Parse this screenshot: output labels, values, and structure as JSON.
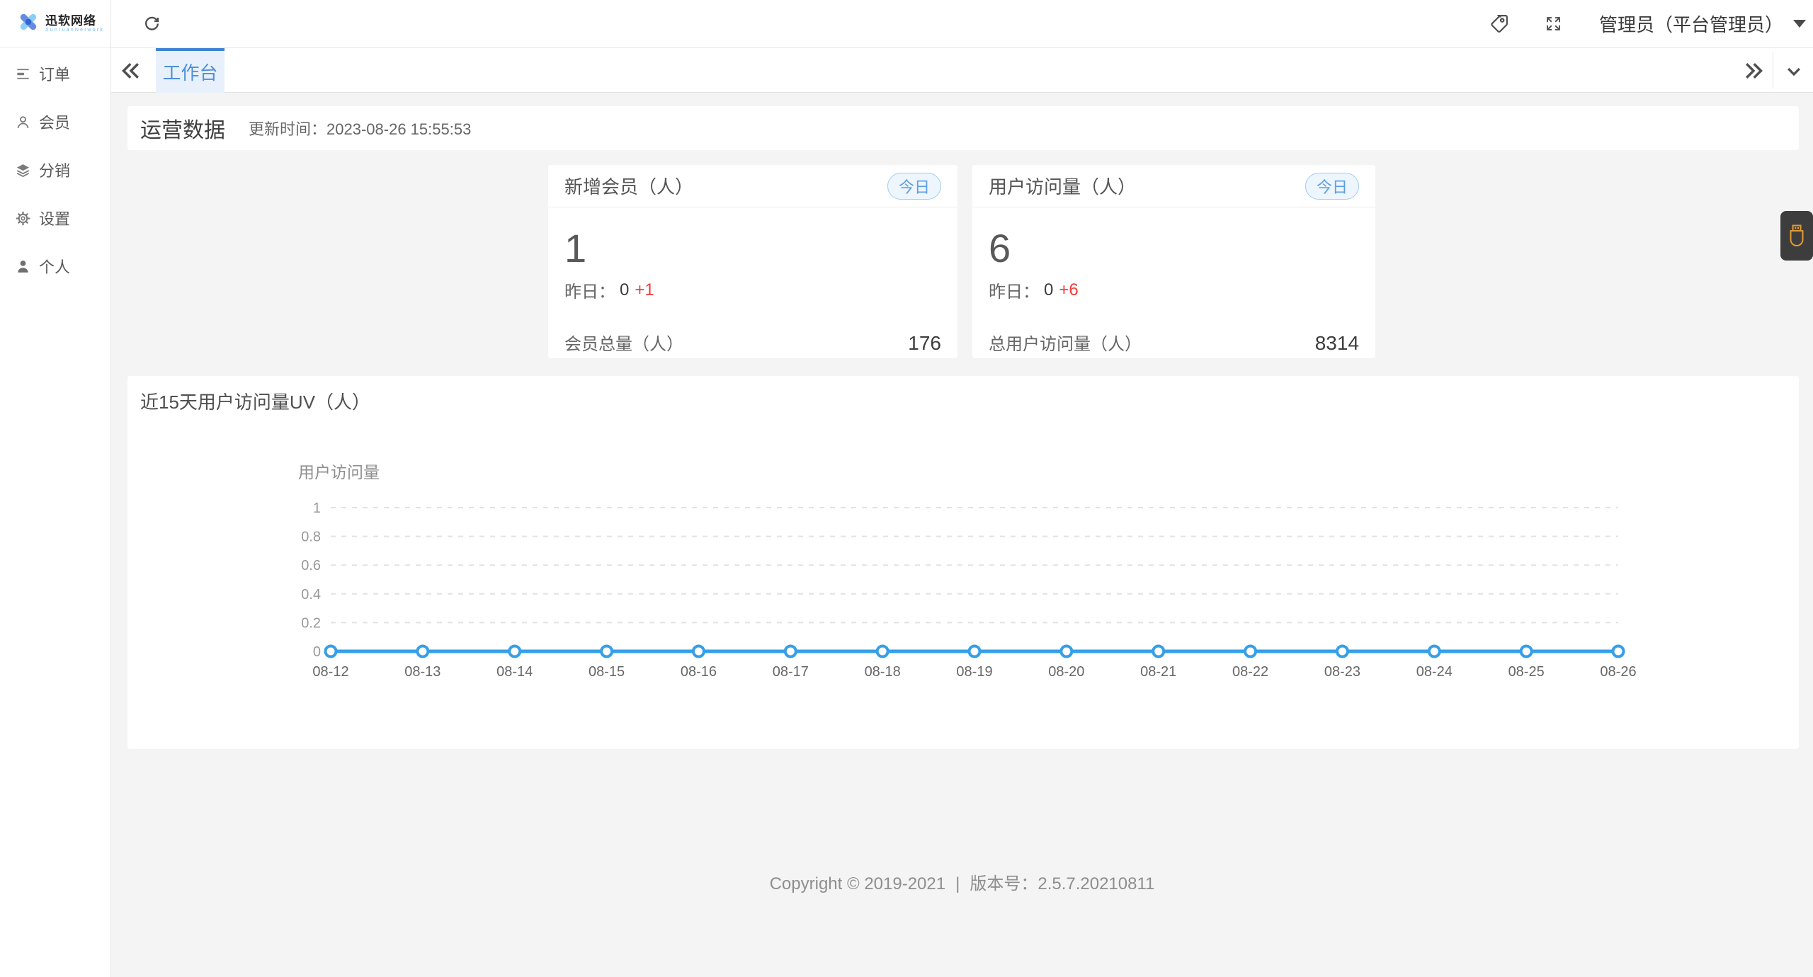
{
  "brand": {
    "name": "迅软网络",
    "tagline": "XunruanNetwork"
  },
  "sidebar": {
    "items": [
      {
        "label": "订单",
        "icon": "order-list-icon"
      },
      {
        "label": "会员",
        "icon": "member-user-icon"
      },
      {
        "label": "分销",
        "icon": "distribution-layers-icon"
      },
      {
        "label": "设置",
        "icon": "settings-gear-icon"
      },
      {
        "label": "个人",
        "icon": "profile-person-icon"
      }
    ]
  },
  "topbar": {
    "user": "管理员（平台管理员）"
  },
  "tabbar": {
    "active_tab": "工作台"
  },
  "ops": {
    "title": "运营数据",
    "update_label": "更新时间：",
    "update_time": "2023-08-26 15:55:53"
  },
  "cards": [
    {
      "title": "新增会员（人）",
      "badge": "今日",
      "value": "1",
      "yesterday_label": "昨日：",
      "yesterday_value": "0",
      "delta": "+1",
      "total_label": "会员总量（人）",
      "total_value": "176"
    },
    {
      "title": "用户访问量（人）",
      "badge": "今日",
      "value": "6",
      "yesterday_label": "昨日：",
      "yesterday_value": "0",
      "delta": "+6",
      "total_label": "总用户访问量（人）",
      "total_value": "8314"
    }
  ],
  "uv_card": {
    "title": "近15天用户访问量UV（人）"
  },
  "chart_data": {
    "type": "line",
    "title": "近15天用户访问量UV（人）",
    "legend": [
      "用户访问量"
    ],
    "legend_position": "top-left",
    "categories": [
      "08-12",
      "08-13",
      "08-14",
      "08-15",
      "08-16",
      "08-17",
      "08-18",
      "08-19",
      "08-20",
      "08-21",
      "08-22",
      "08-23",
      "08-24",
      "08-25",
      "08-26"
    ],
    "series": [
      {
        "name": "用户访问量",
        "values": [
          0,
          0,
          0,
          0,
          0,
          0,
          0,
          0,
          0,
          0,
          0,
          0,
          0,
          0,
          0
        ]
      }
    ],
    "xlabel": "",
    "ylabel": "",
    "ylim": [
      0,
      1
    ],
    "yticks": [
      0,
      0.2,
      0.4,
      0.6,
      0.8,
      1
    ],
    "grid": "horizontal-dashed",
    "line_color": "#359fe8",
    "marker": "open-circle"
  },
  "footer": {
    "copyright": "Copyright © 2019-2021",
    "separator": "|",
    "version": "版本号：2.5.7.20210811"
  },
  "colors": {
    "tab_accent": "#3f83d4",
    "tab_text": "#4e8fd9",
    "badge_text": "#5b9fe2",
    "badge_border": "#a5cbf0",
    "badge_bg": "#edf5fd",
    "delta_red": "#ef3b3b",
    "chart_line": "#359fe8",
    "content_bg": "#f4f4f4",
    "widget_bg": "#3d3d3d",
    "widget_icon": "#e09a35"
  }
}
